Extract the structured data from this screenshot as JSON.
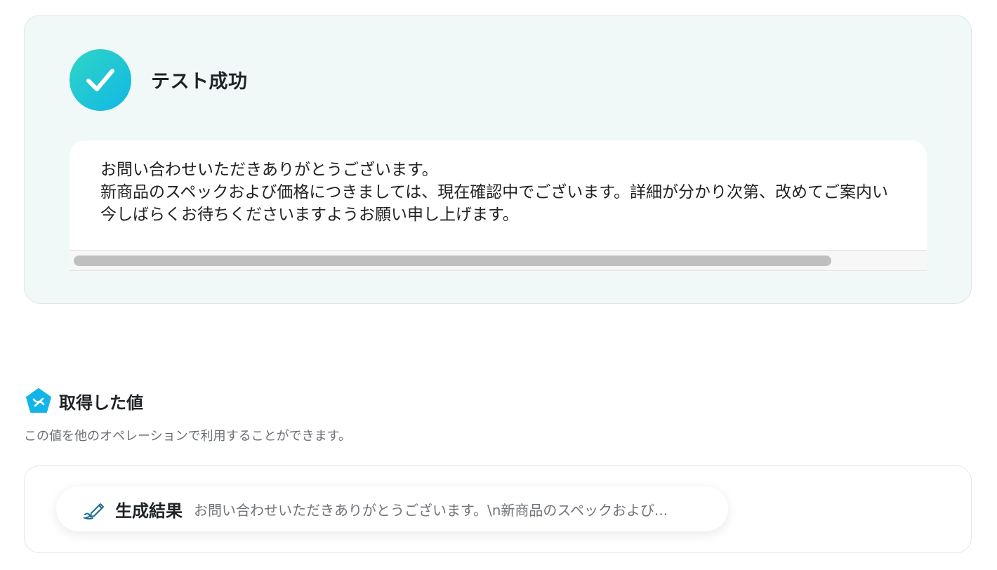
{
  "success_panel": {
    "title": "テスト成功",
    "icon": "check-icon",
    "output_lines": [
      "お問い合わせいただきありがとうございます。",
      "新商品のスペックおよび価格につきましては、現在確認中でございます。詳細が分かり次第、改めてご案内い",
      "今しばらくお待ちくださいますようお願い申し上げます。"
    ]
  },
  "values_section": {
    "icon": "variable-pentagon-icon",
    "title": "取得した値",
    "description": "この値を他のオペレーションで利用することができます。",
    "items": [
      {
        "icon": "pen-icon",
        "label": "生成結果",
        "value": "お問い合わせいただきありがとうございます。\\n新商品のスペックおよび..."
      }
    ]
  },
  "colors": {
    "panel_bg": "#f1f9f8",
    "accent_start": "#2fd6c4",
    "accent_end": "#11b7e6",
    "pentagon": "#13b5e8",
    "pen_stroke": "#1b6b8a"
  }
}
